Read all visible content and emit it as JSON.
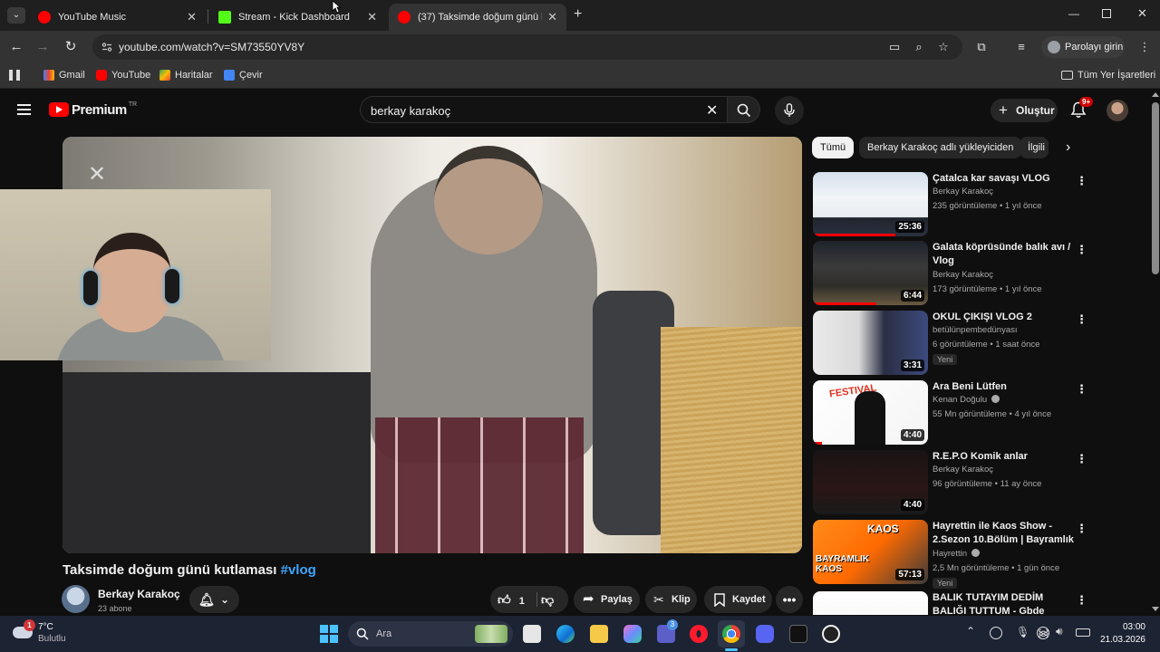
{
  "browser": {
    "tabs": [
      {
        "title": "YouTube Music",
        "active": false
      },
      {
        "title": "Stream - Kick Dashboard",
        "active": false
      },
      {
        "title": "(37) Taksimde doğum günü kutlaması",
        "active": true
      }
    ],
    "url": "youtube.com/watch?v=SM73550YV8Y",
    "signin_label": "Parolayı girin",
    "bookmarks": [
      "Gmail",
      "YouTube",
      "Haritalar",
      "Çevir"
    ],
    "all_bookmarks_label": "Tüm Yer İşaretleri"
  },
  "youtube": {
    "logo_text": "Premium",
    "logo_region": "TR",
    "search_query": "berkay karakoç",
    "create_label": "Oluştur",
    "notification_count": "9+",
    "chips": [
      "Tümü",
      "Berkay Karakoç adlı yükleyiciden",
      "İlgili"
    ],
    "video": {
      "title": "Taksimde doğum günü kutlaması",
      "hashtag": "#vlog",
      "channel": "Berkay Karakoç",
      "subscribers": "23 abone",
      "likes": "1",
      "share_label": "Paylaş",
      "clip_label": "Klip",
      "save_label": "Kaydet"
    },
    "recommendations": [
      {
        "title": "Çatalca kar savaşı VLOG",
        "channel": "Berkay Karakoç",
        "meta": "235 görüntüleme • 1 yıl önce",
        "duration": "25:36",
        "badge": "",
        "verified": false,
        "progress": 0.72
      },
      {
        "title": "Galata köprüsünde balık avı / Vlog",
        "channel": "Berkay Karakoç",
        "meta": "173 görüntüleme • 1 yıl önce",
        "duration": "6:44",
        "badge": "",
        "verified": false,
        "progress": 0.55
      },
      {
        "title": "OKUL ÇIKIŞI VLOG 2",
        "channel": "betülünpembedünyası",
        "meta": "6 görüntüleme • 1 saat önce",
        "duration": "3:31",
        "badge": "Yeni",
        "verified": false,
        "progress": 0
      },
      {
        "title": "Ara Beni Lütfen",
        "channel": "Kenan Doğulu",
        "meta": "55 Mn görüntüleme • 4 yıl önce",
        "duration": "4:40",
        "badge": "",
        "verified": true,
        "progress": 0.08
      },
      {
        "title": "R.E.P.O Komik anlar",
        "channel": "Berkay Karakoç",
        "meta": "96 görüntüleme • 11 ay önce",
        "duration": "4:40",
        "badge": "",
        "verified": false,
        "progress": 0
      },
      {
        "title": "Hayrettin ile Kaos Show - 2.Sezon 10.Bölüm | Bayramlık ...",
        "channel": "Hayrettin",
        "meta": "2,5 Mn görüntüleme • 1 gün önce",
        "duration": "57:13",
        "badge": "Yeni",
        "verified": true,
        "progress": 0
      },
      {
        "title": "BALIK TUTAYIM DEDİM BALIĞI TUTTUM - Gbde hipotermi keyfi",
        "channel": "",
        "meta": "",
        "duration": "",
        "badge": "",
        "verified": false,
        "progress": 0
      }
    ],
    "thumb_texts": {
      "festival": "FESTIVAL",
      "kaos": "KAOS",
      "bayramlik": "BAYRAMLIK KAOS"
    }
  },
  "taskbar": {
    "weather_temp": "7°C",
    "weather_desc": "Bulutlu",
    "weather_badge": "1",
    "search_placeholder": "Ara",
    "time": "03:00",
    "date": "21.03.2026",
    "teams_badge": "3"
  },
  "colors": {
    "yt_red": "#ff0000",
    "link_blue": "#3ea6ff",
    "bg": "#0f0f0f"
  }
}
